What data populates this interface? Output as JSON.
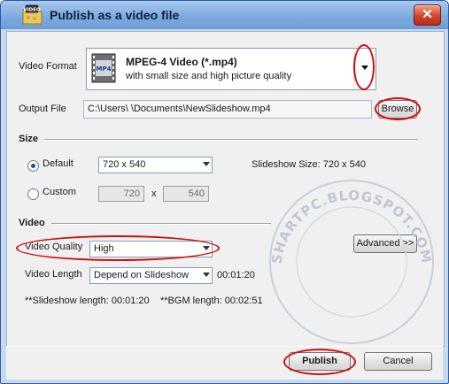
{
  "window": {
    "title": "Publish as a video file",
    "app_icon": "video-folder-icon",
    "close_icon": "close-icon",
    "close_glyph": "✕"
  },
  "video_format": {
    "label": "Video Format",
    "name": "MPEG-4 Video (*.mp4)",
    "description": "with small size and high picture quality",
    "icon": "film-mp4-icon",
    "icon_text": "MP4"
  },
  "output_file": {
    "label": "Output File",
    "path": "C:\\Users\\            \\Documents\\NewSlideshow.mp4",
    "browse_label": "Browse"
  },
  "size": {
    "section_label": "Size",
    "default_label": "Default",
    "default_value": "720 x 540",
    "slideshow_size": "Slideshow Size: 720 x 540",
    "custom_label": "Custom",
    "custom_width": "720",
    "separator": "x",
    "custom_height": "540",
    "selected": "default"
  },
  "video": {
    "section_label": "Video",
    "quality_label": "Video Quality",
    "quality_value": "High",
    "advanced_label": "Advanced >>",
    "length_label": "Video Length",
    "length_value": "Depend on Slideshow",
    "length_time": "00:01:20",
    "slideshow_length": "**Slideshow length: 00:01:20",
    "bgm_length": "**BGM length: 00:02:51"
  },
  "footer": {
    "publish_label": "Publish",
    "cancel_label": "Cancel"
  },
  "watermark": {
    "text": "SHARTPC.BLOGSPOT.COM"
  },
  "colors": {
    "titlebar": "#7eaae0",
    "highlight_oval": "#cc1010",
    "radio_dot": "#1d4f9e"
  }
}
